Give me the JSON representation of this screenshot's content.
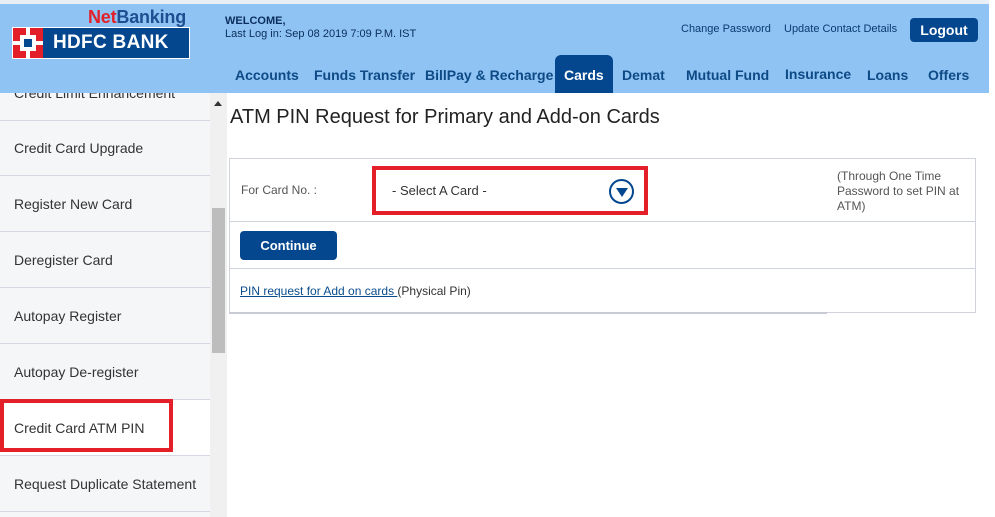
{
  "brand": {
    "net": "Net",
    "banking": "Banking",
    "bank_name": "HDFC BANK",
    "colors": {
      "red": "#e3202a",
      "navy": "#05478f",
      "header_bg": "#8ec3f3"
    }
  },
  "welcome": {
    "greeting": "WELCOME,",
    "last_login": "Last Log in: Sep 08 2019 7:09 P.M. IST"
  },
  "top_links": {
    "change_password": "Change Password",
    "update_contact": "Update Contact Details",
    "logout": "Logout"
  },
  "nav": {
    "items": [
      {
        "label": "Accounts"
      },
      {
        "label": "Funds Transfer"
      },
      {
        "label": "BillPay & Recharge"
      },
      {
        "label": "Cards",
        "active": true
      },
      {
        "label": "Demat"
      },
      {
        "label": "Mutual Fund"
      },
      {
        "label": "Insurance"
      },
      {
        "label": "Loans"
      },
      {
        "label": "Offers"
      }
    ]
  },
  "sidebar": {
    "items": [
      {
        "label": "Credit Limit Enhancement"
      },
      {
        "label": "Credit Card Upgrade"
      },
      {
        "label": "Register New Card"
      },
      {
        "label": "Deregister Card"
      },
      {
        "label": "Autopay Register"
      },
      {
        "label": "Autopay De-register"
      },
      {
        "label": "Credit Card ATM PIN",
        "selected": true
      },
      {
        "label": "Request Duplicate Statement"
      }
    ]
  },
  "main": {
    "title": "ATM PIN Request for Primary and Add-on Cards",
    "card_label": "For Card No. :",
    "card_select_value": "- Select A Card -",
    "note": "(Through One Time Password to set PIN at ATM)",
    "continue_label": "Continue",
    "pin_link": "PIN request for Add on cards ",
    "pin_suffix": "(Physical Pin)"
  }
}
